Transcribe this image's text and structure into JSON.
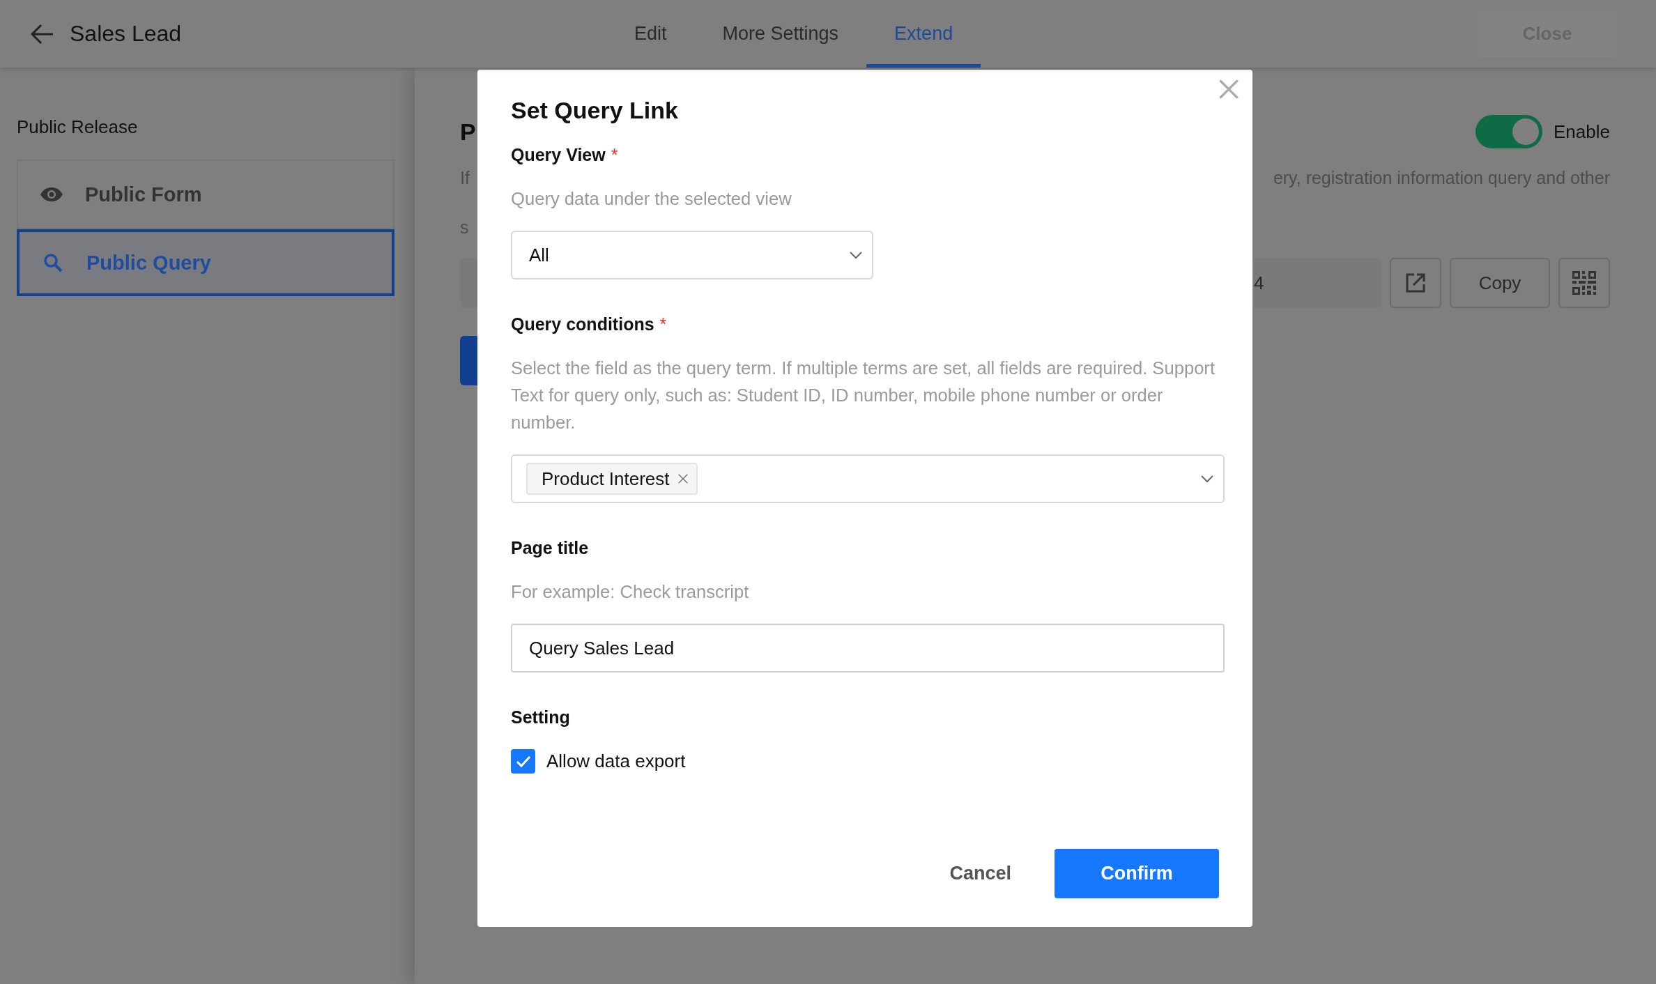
{
  "header": {
    "title": "Sales Lead",
    "tabs": [
      {
        "label": "Edit",
        "selected": false
      },
      {
        "label": "More Settings",
        "selected": false
      },
      {
        "label": "Extend",
        "selected": true
      }
    ],
    "close_button": "Close"
  },
  "sidebar": {
    "heading": "Public Release",
    "items": [
      {
        "kind": "form",
        "label": "Public Form",
        "selected": false
      },
      {
        "kind": "query",
        "label": "Public Query",
        "selected": true
      }
    ]
  },
  "main": {
    "heading": "P",
    "description_start": [
      "If",
      "s"
    ],
    "description_end": "ery, registration information query and other",
    "toggle": {
      "on": true,
      "label": "Enable"
    },
    "link_end": "4",
    "copy_button": "Copy"
  },
  "dialog": {
    "title": "Set Query Link",
    "fields": [
      {
        "kind": "select",
        "label": "Query View",
        "required_mark": "*",
        "hint": "Query data under the selected view",
        "value": "All"
      },
      {
        "kind": "tags",
        "label": "Query conditions",
        "required_mark": "*",
        "hint": "Select the field as the query term. If multiple terms are set, all fields are required. Support Text for query only, such as: Student ID, ID number, mobile phone number or order number.",
        "tags": [
          "Product Interest"
        ]
      },
      {
        "kind": "text",
        "label": "Page title",
        "hint": "For example: Check transcript",
        "value": "Query Sales Lead"
      },
      {
        "kind": "checkbox",
        "label": "Setting",
        "option": "Allow data export",
        "checked": true
      }
    ],
    "cancel_button": "Cancel",
    "confirm_button": "Confirm"
  }
}
